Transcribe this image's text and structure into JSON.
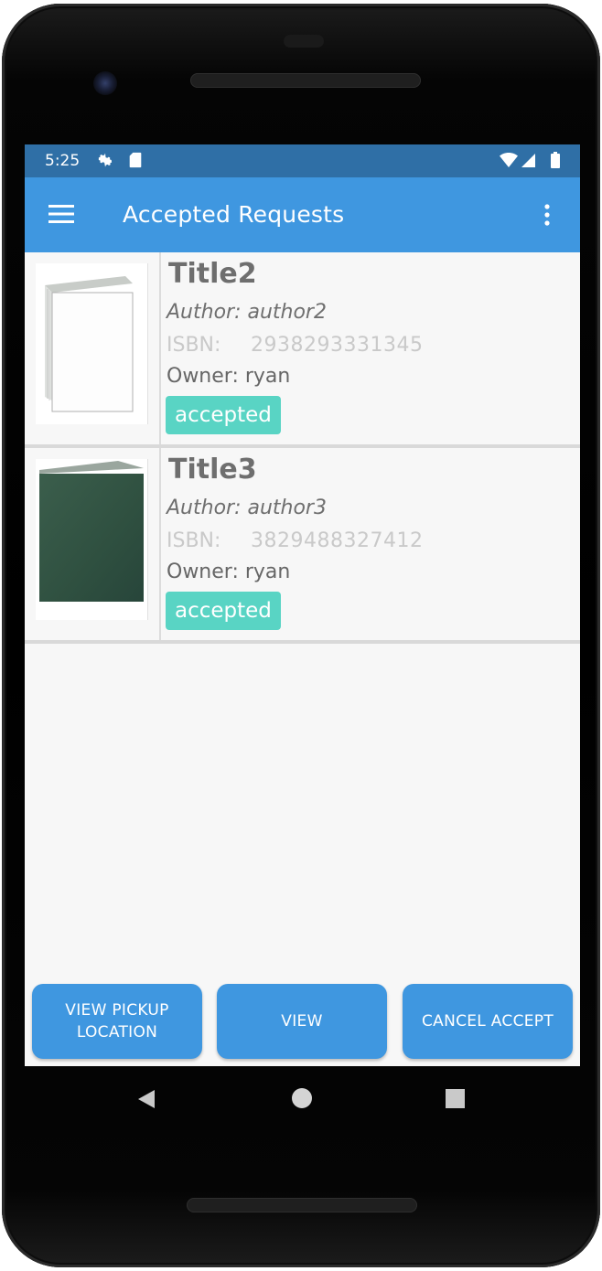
{
  "status_bar": {
    "time": "5:25",
    "icons": [
      "settings-icon",
      "sd-card-icon",
      "wifi-icon",
      "signal-icon",
      "battery-icon"
    ]
  },
  "app_bar": {
    "title": "Accepted Requests",
    "menu_icon": "hamburger-menu-icon",
    "overflow_icon": "more-vert-icon"
  },
  "requests": [
    {
      "title": "Title2",
      "author": "Author: author2",
      "isbn_label": "ISBN:",
      "isbn": "2938293331345",
      "owner": "Owner: ryan",
      "status": "accepted",
      "cover": "white-book-cover"
    },
    {
      "title": "Title3",
      "author": "Author: author3",
      "isbn_label": "ISBN:",
      "isbn": "3829488327412",
      "owner": "Owner: ryan",
      "status": "accepted",
      "cover": "green-book-cover"
    }
  ],
  "buttons": {
    "view_pickup_location": "VIEW PICKUP LOCATION",
    "view": "VIEW",
    "cancel_accept": "CANCEL ACCEPT"
  },
  "navigation": {
    "back": "back-icon",
    "home": "home-icon",
    "recents": "recents-icon"
  },
  "colors": {
    "status_bar": "#2f6fa6",
    "app_bar": "#3f97e0",
    "button": "#3f97e0",
    "chip": "#59d4c4"
  }
}
